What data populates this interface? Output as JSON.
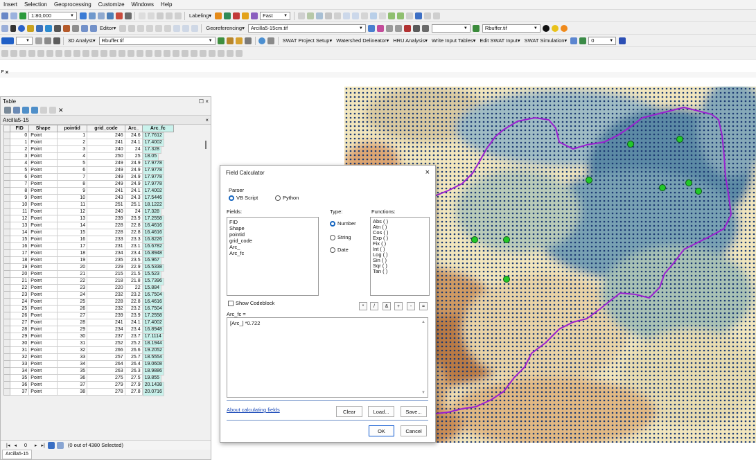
{
  "menu": [
    "Insert",
    "Selection",
    "Geoprocessing",
    "Customize",
    "Windows",
    "Help"
  ],
  "toolbar1": {
    "scale": "1:80,000",
    "labeling": "Labeling",
    "fast": "Fast"
  },
  "toolbar2": {
    "editor": "Editor",
    "georeferencing": "Georeferencing",
    "layer": "Arcilla5-15cm.tif",
    "rbuffer": "Rbuffer.tif"
  },
  "toolbar3": {
    "analyst": "3D Analyst",
    "layer": "Rbuffer.tif",
    "swat_items": [
      "SWAT Project Setup",
      "Watershed Delineator",
      "HRU Analysis",
      "Write Input Tables",
      "Edit SWAT Input",
      "SWAT Simulation"
    ],
    "num": "0"
  },
  "table_window": {
    "title": "Table",
    "tab_name": "Arcilla5-15",
    "bottom_tab": "Arcilla5-15",
    "status_pos": "0",
    "status": "(0 out of 4380 Selected)",
    "columns": [
      "FID",
      "Shape",
      "pointid",
      "grid_code",
      "Arc_",
      "Arc_fc"
    ],
    "rows": [
      [
        "0",
        "Point",
        "1",
        "246",
        "24.6",
        "17.7612"
      ],
      [
        "1",
        "Point",
        "2",
        "241",
        "24.1",
        "17.4002"
      ],
      [
        "2",
        "Point",
        "3",
        "240",
        "24",
        "17.328"
      ],
      [
        "3",
        "Point",
        "4",
        "250",
        "25",
        "18.05"
      ],
      [
        "4",
        "Point",
        "5",
        "249",
        "24.9",
        "17.9778"
      ],
      [
        "5",
        "Point",
        "6",
        "249",
        "24.9",
        "17.9778"
      ],
      [
        "6",
        "Point",
        "7",
        "249",
        "24.9",
        "17.9778"
      ],
      [
        "7",
        "Point",
        "8",
        "249",
        "24.9",
        "17.9778"
      ],
      [
        "8",
        "Point",
        "9",
        "241",
        "24.1",
        "17.4002"
      ],
      [
        "9",
        "Point",
        "10",
        "243",
        "24.3",
        "17.5446"
      ],
      [
        "10",
        "Point",
        "11",
        "251",
        "25.1",
        "18.1222"
      ],
      [
        "11",
        "Point",
        "12",
        "240",
        "24",
        "17.328"
      ],
      [
        "12",
        "Point",
        "13",
        "239",
        "23.9",
        "17.2558"
      ],
      [
        "13",
        "Point",
        "14",
        "228",
        "22.8",
        "16.4616"
      ],
      [
        "14",
        "Point",
        "15",
        "228",
        "22.8",
        "16.4616"
      ],
      [
        "15",
        "Point",
        "16",
        "233",
        "23.3",
        "16.8226"
      ],
      [
        "16",
        "Point",
        "17",
        "231",
        "23.1",
        "16.6782"
      ],
      [
        "17",
        "Point",
        "18",
        "234",
        "23.4",
        "16.8948"
      ],
      [
        "18",
        "Point",
        "19",
        "235",
        "23.5",
        "16.967"
      ],
      [
        "19",
        "Point",
        "20",
        "229",
        "22.9",
        "16.5338"
      ],
      [
        "20",
        "Point",
        "21",
        "215",
        "21.5",
        "15.523"
      ],
      [
        "21",
        "Point",
        "22",
        "218",
        "21.8",
        "15.7396"
      ],
      [
        "22",
        "Point",
        "23",
        "220",
        "22",
        "15.884"
      ],
      [
        "23",
        "Point",
        "24",
        "232",
        "23.2",
        "16.7504"
      ],
      [
        "24",
        "Point",
        "25",
        "228",
        "22.8",
        "16.4616"
      ],
      [
        "25",
        "Point",
        "26",
        "232",
        "23.2",
        "16.7504"
      ],
      [
        "26",
        "Point",
        "27",
        "239",
        "23.9",
        "17.2558"
      ],
      [
        "27",
        "Point",
        "28",
        "241",
        "24.1",
        "17.4002"
      ],
      [
        "28",
        "Point",
        "29",
        "234",
        "23.4",
        "16.8948"
      ],
      [
        "29",
        "Point",
        "30",
        "237",
        "23.7",
        "17.1114"
      ],
      [
        "30",
        "Point",
        "31",
        "252",
        "25.2",
        "18.1944"
      ],
      [
        "31",
        "Point",
        "32",
        "266",
        "26.6",
        "19.2052"
      ],
      [
        "32",
        "Point",
        "33",
        "257",
        "25.7",
        "18.5554"
      ],
      [
        "33",
        "Point",
        "34",
        "264",
        "26.4",
        "19.0608"
      ],
      [
        "34",
        "Point",
        "35",
        "263",
        "26.3",
        "18.9886"
      ],
      [
        "35",
        "Point",
        "36",
        "275",
        "27.5",
        "19.855"
      ],
      [
        "36",
        "Point",
        "37",
        "279",
        "27.9",
        "20.1438"
      ],
      [
        "37",
        "Point",
        "38",
        "278",
        "27.8",
        "20.0716"
      ]
    ]
  },
  "field_calculator": {
    "title": "Field Calculator",
    "parser_label": "Parser",
    "parser_vb": "VB Script",
    "parser_py": "Python",
    "fields_label": "Fields:",
    "fields": [
      "FID",
      "Shape",
      "pointid",
      "grid_code",
      "Arc_",
      "Arc_fc"
    ],
    "type_label": "Type:",
    "types": [
      "Number",
      "String",
      "Date"
    ],
    "functions_label": "Functions:",
    "functions": [
      "Abs ( )",
      "Atn ( )",
      "Cos ( )",
      "Exp ( )",
      "Fix ( )",
      "Int ( )",
      "Log ( )",
      "Sin ( )",
      "Sqr ( )",
      "Tan ( )"
    ],
    "show_codeblock": "Show Codeblock",
    "operators": [
      "*",
      "/",
      "&",
      "+",
      "-",
      "="
    ],
    "target_label": "Arc_fc =",
    "expression": "[Arc_] *0.722",
    "about_link": "About calculating fields",
    "clear": "Clear",
    "load": "Load...",
    "save": "Save...",
    "ok": "OK",
    "cancel": "Cancel"
  },
  "colors": {
    "accent": "#1565c0",
    "field_highlight": "#c9f2ec",
    "watershed_line": "#9b1fd1",
    "point_marker": "#1b3a73",
    "selected_point": "#22c82a"
  }
}
